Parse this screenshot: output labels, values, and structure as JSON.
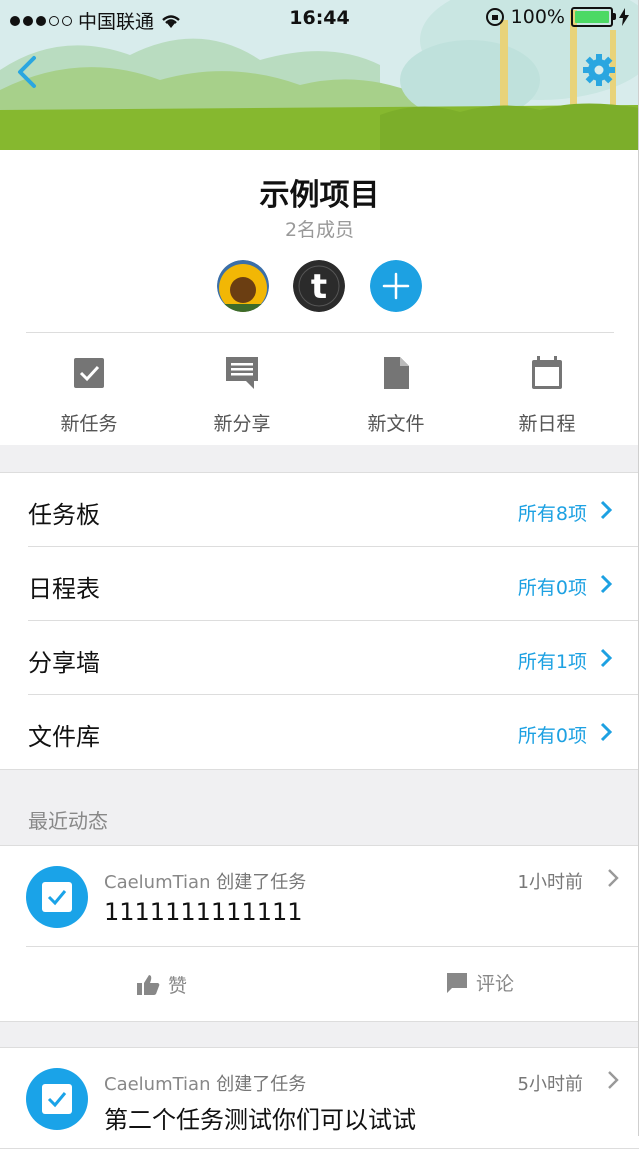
{
  "status_bar": {
    "carrier": "中国联通",
    "time": "16:44",
    "battery": "100%"
  },
  "project": {
    "title": "示例项目",
    "members": "2名成员"
  },
  "actions": [
    {
      "label": "新任务",
      "icon": "checkbox-icon"
    },
    {
      "label": "新分享",
      "icon": "share-message-icon"
    },
    {
      "label": "新文件",
      "icon": "file-icon"
    },
    {
      "label": "新日程",
      "icon": "calendar-icon"
    }
  ],
  "sections": [
    {
      "label": "任务板",
      "count": "所有8项"
    },
    {
      "label": "日程表",
      "count": "所有0项"
    },
    {
      "label": "分享墙",
      "count": "所有1项"
    },
    {
      "label": "文件库",
      "count": "所有0项"
    }
  ],
  "recent": {
    "label": "最近动态",
    "items": [
      {
        "user": "CaelumTian",
        "action": "创建了任务",
        "time": "1小时前",
        "content": "1111111111111",
        "like": "赞",
        "comment": "评论"
      },
      {
        "user": "CaelumTian",
        "action": "创建了任务",
        "time": "5小时前",
        "content": "第二个任务测试你们可以试试"
      }
    ]
  },
  "colors": {
    "accent": "#1da1e2",
    "badge": "#1aa3e8"
  }
}
